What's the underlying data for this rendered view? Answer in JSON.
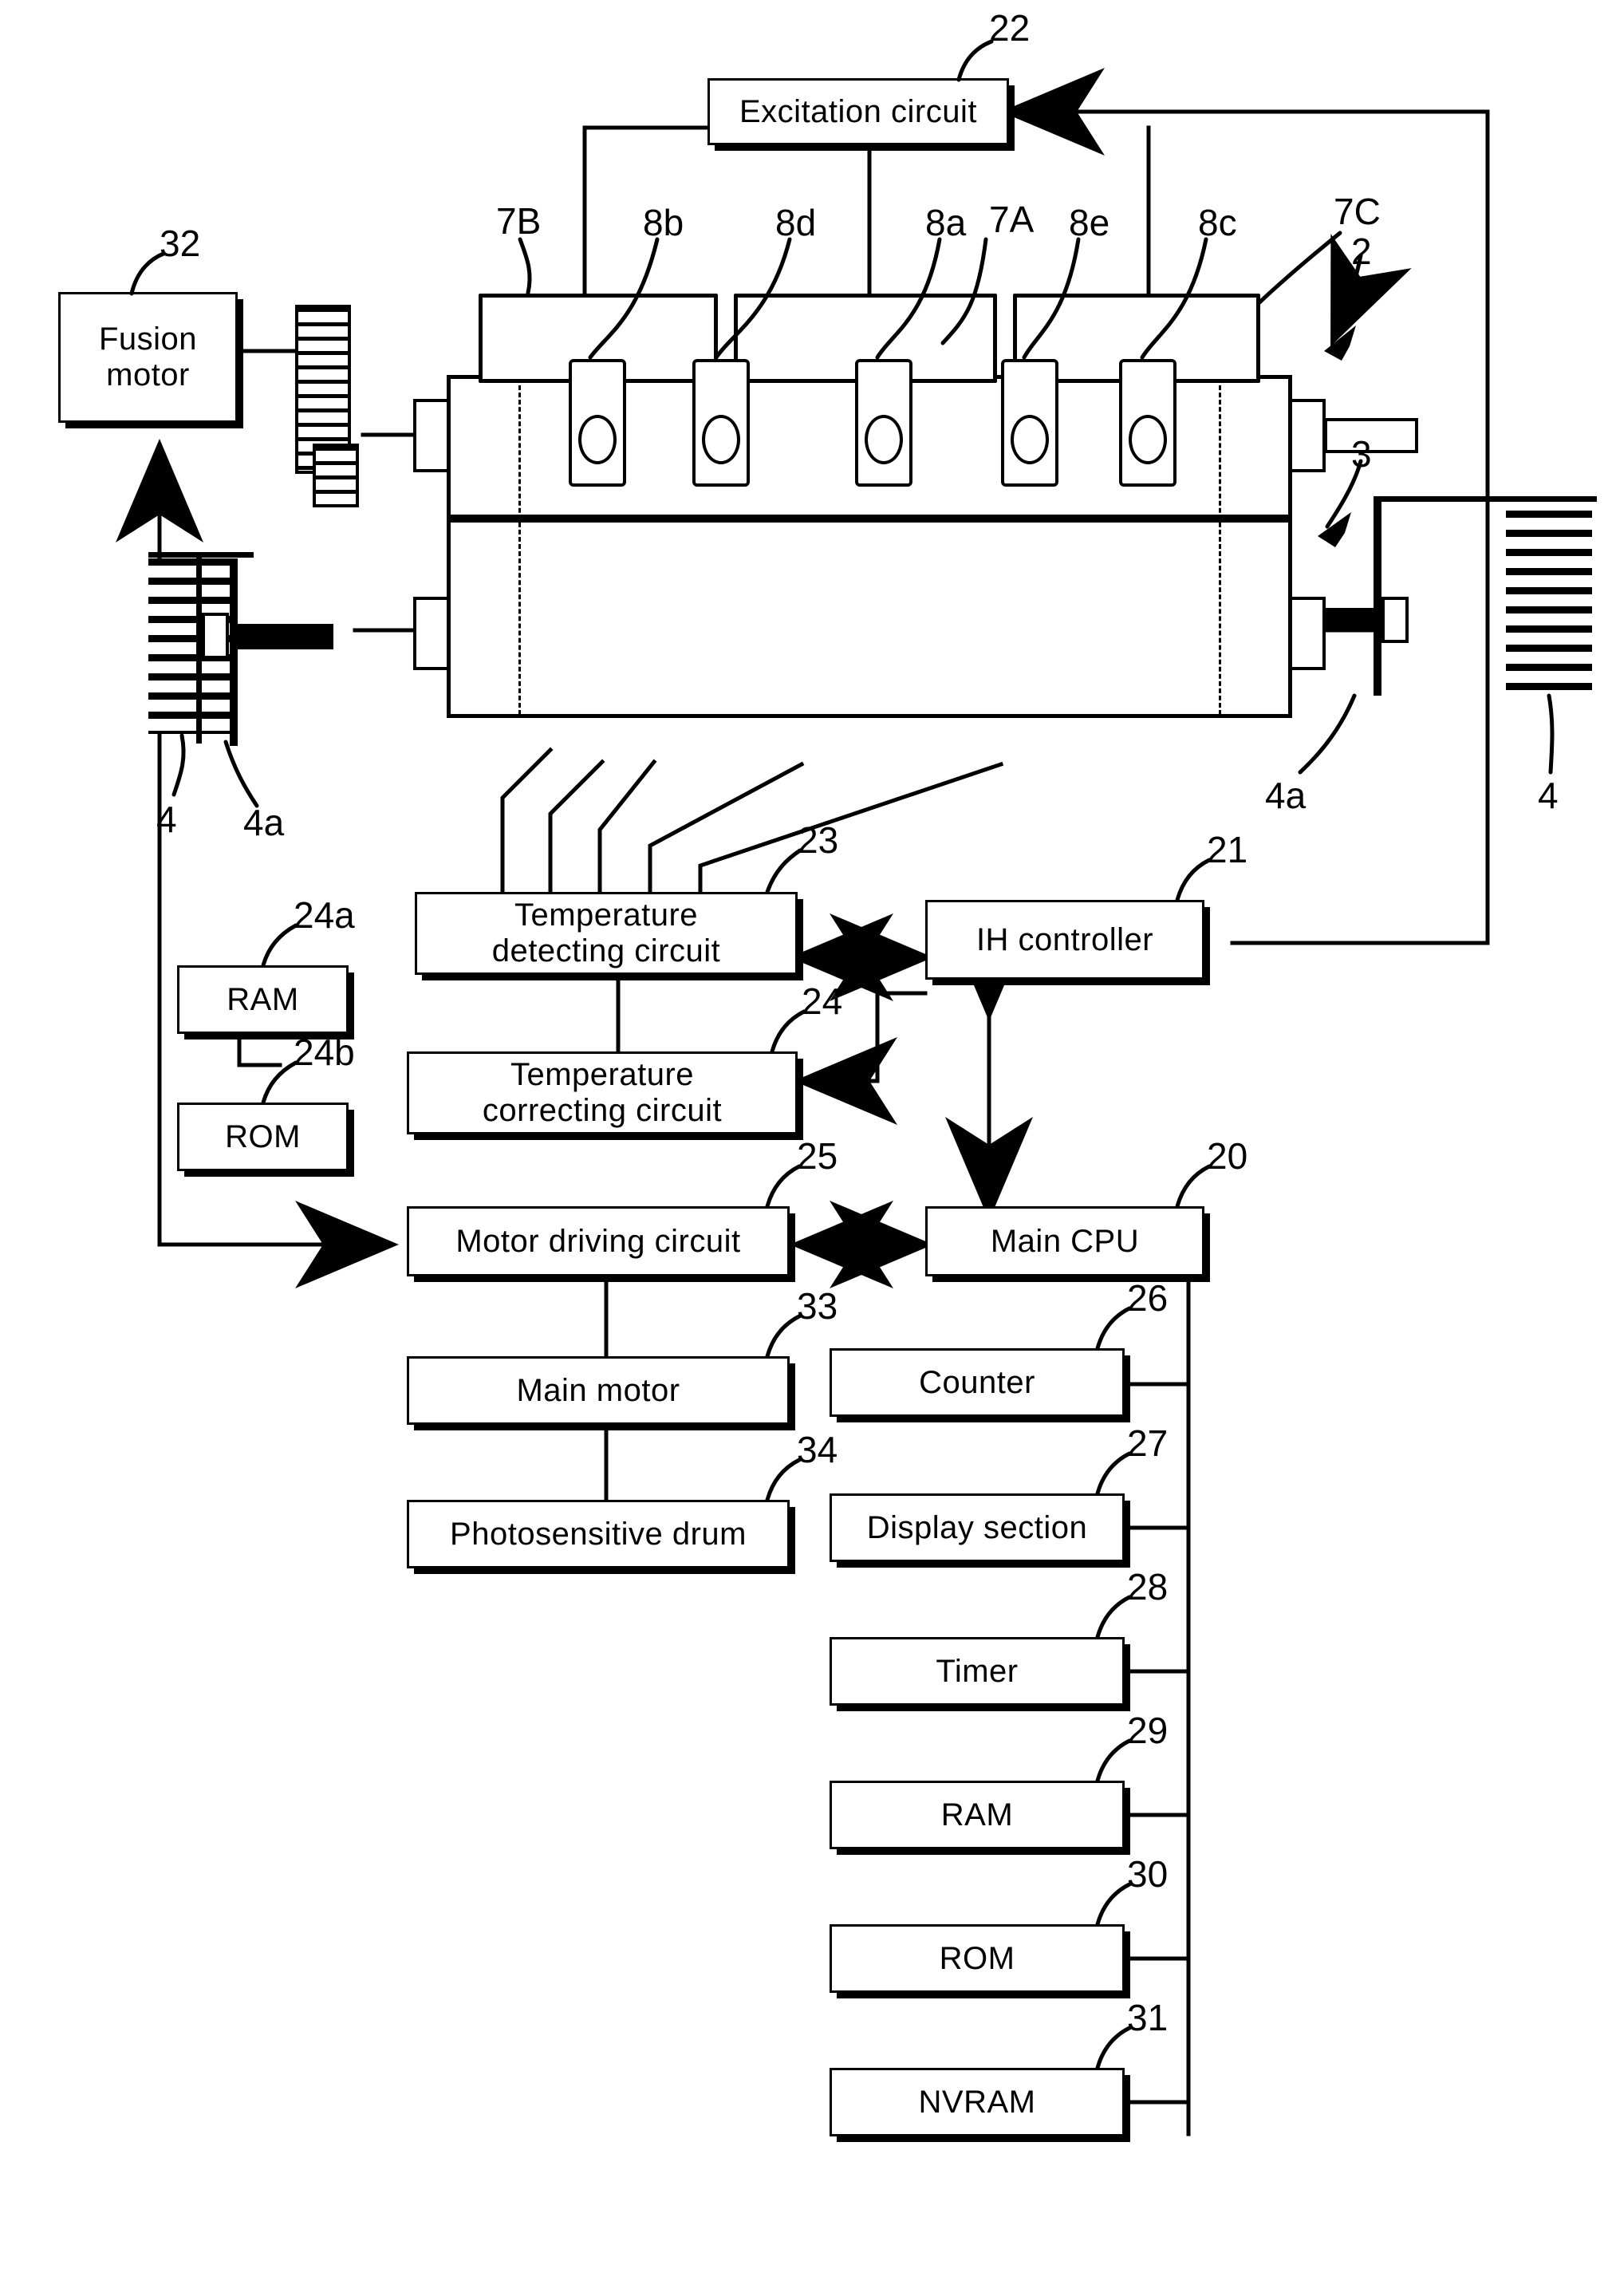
{
  "figure": {
    "type": "patent-block-diagram",
    "description": "Induction heating fusing unit control block diagram"
  },
  "blocks": [
    {
      "id": "excitation",
      "label": "Excitation circuit",
      "ref": "22",
      "lines": [
        "Excitation circuit"
      ]
    },
    {
      "id": "fusion_motor",
      "label": "Fusion motor",
      "ref": "32",
      "lines": [
        "Fusion",
        "motor"
      ]
    },
    {
      "id": "temp_detect",
      "label": "Temperature detecting circuit",
      "ref": "23",
      "lines": [
        "Temperature",
        "detecting  circuit"
      ]
    },
    {
      "id": "ih_ctrl",
      "label": "IH controller",
      "ref": "21",
      "lines": [
        "IH  controller"
      ]
    },
    {
      "id": "ram_24a",
      "label": "RAM",
      "ref": "24a",
      "lines": [
        "RAM"
      ]
    },
    {
      "id": "temp_correct",
      "label": "Temperature correcting circuit",
      "ref": "24",
      "lines": [
        "Temperature",
        "correcting  circuit"
      ]
    },
    {
      "id": "rom_24b",
      "label": "ROM",
      "ref": "24b",
      "lines": [
        "ROM"
      ]
    },
    {
      "id": "motor_drive",
      "label": "Motor driving circuit",
      "ref": "25",
      "lines": [
        "Motor  driving  circuit"
      ]
    },
    {
      "id": "main_cpu",
      "label": "Main CPU",
      "ref": "20",
      "lines": [
        "Main  CPU"
      ]
    },
    {
      "id": "main_motor",
      "label": "Main motor",
      "ref": "33",
      "lines": [
        "Main  motor"
      ]
    },
    {
      "id": "counter",
      "label": "Counter",
      "ref": "26",
      "lines": [
        "Counter"
      ]
    },
    {
      "id": "photo_drum",
      "label": "Photosensitive drum",
      "ref": "34",
      "lines": [
        "Photosensitive  drum"
      ]
    },
    {
      "id": "display",
      "label": "Display section",
      "ref": "27",
      "lines": [
        "Display  section"
      ]
    },
    {
      "id": "timer",
      "label": "Timer",
      "ref": "28",
      "lines": [
        "Timer"
      ]
    },
    {
      "id": "ram_29",
      "label": "RAM",
      "ref": "29",
      "lines": [
        "RAM"
      ]
    },
    {
      "id": "rom_30",
      "label": "ROM",
      "ref": "30",
      "lines": [
        "ROM"
      ]
    },
    {
      "id": "nvram",
      "label": "NVRAM",
      "ref": "31",
      "lines": [
        "NVRAM"
      ]
    }
  ],
  "mech_refs": [
    {
      "id": "r_7B",
      "text": "7B"
    },
    {
      "id": "r_8b",
      "text": "8b"
    },
    {
      "id": "r_8d",
      "text": "8d"
    },
    {
      "id": "r_8a",
      "text": "8a"
    },
    {
      "id": "r_7A",
      "text": "7A"
    },
    {
      "id": "r_8e",
      "text": "8e"
    },
    {
      "id": "r_8c",
      "text": "8c"
    },
    {
      "id": "r_7C",
      "text": "7C"
    },
    {
      "id": "r_2",
      "text": "2"
    },
    {
      "id": "r_3",
      "text": "3"
    },
    {
      "id": "r_4L",
      "text": "4"
    },
    {
      "id": "r_4aL",
      "text": "4a"
    },
    {
      "id": "r_4aR",
      "text": "4a"
    },
    {
      "id": "r_4R",
      "text": "4"
    }
  ],
  "colors": {
    "ink": "#000000",
    "paper": "#ffffff"
  }
}
